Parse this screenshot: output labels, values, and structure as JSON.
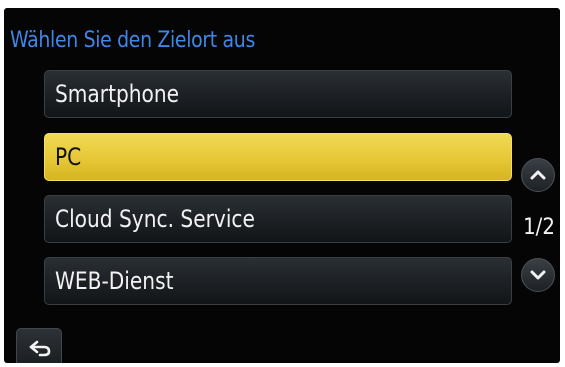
{
  "header": {
    "title": "Wählen Sie den Zielort aus"
  },
  "menu": {
    "items": [
      {
        "label": "Smartphone",
        "selected": false
      },
      {
        "label": "PC",
        "selected": true
      },
      {
        "label": "Cloud Sync. Service",
        "selected": false
      },
      {
        "label": "WEB-Dienst",
        "selected": false
      }
    ]
  },
  "pagination": {
    "indicator": "1/2",
    "up_icon": "chevron-up-icon",
    "down_icon": "chevron-down-icon"
  },
  "footer": {
    "back_icon": "return-arrow-icon"
  },
  "colors": {
    "background": "#050505",
    "title": "#3f86e8",
    "selected": "#e8c938",
    "item": "#1c2024",
    "text": "#f2f2f2"
  }
}
